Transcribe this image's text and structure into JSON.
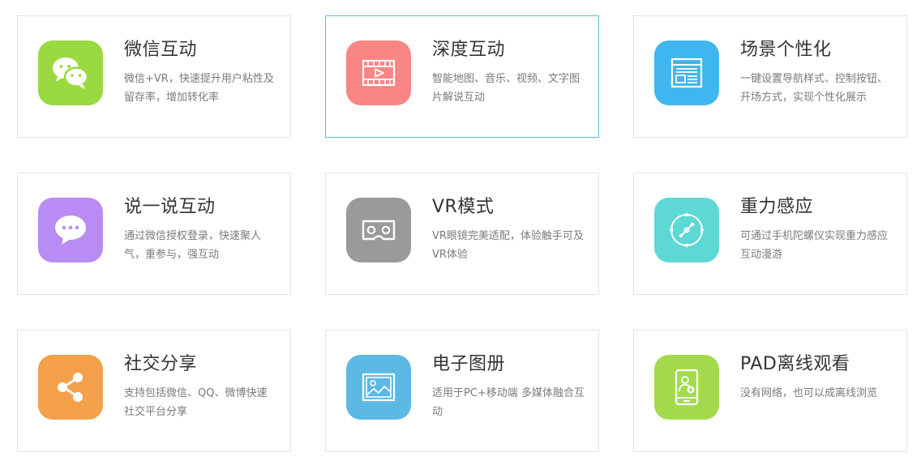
{
  "colors": {
    "wechat": "#9ad940",
    "deep": "#f98585",
    "scene": "#3fb6ef",
    "talk": "#b98cf3",
    "vr": "#9b9999",
    "gravity": "#5dd8d4",
    "social": "#f5a04a",
    "album": "#5cb9e4",
    "pad": "#a3da4b",
    "active_border": "#5bbfd0",
    "border": "#e3e3e3"
  },
  "features": [
    {
      "title": "微信互动",
      "desc": "微信+VR，快速提升用户粘性及留存率，增加转化率",
      "icon": "wechat-icon"
    },
    {
      "title": "深度互动",
      "desc": "智能地图、音乐、视频、文字图片解说互动",
      "icon": "film-icon"
    },
    {
      "title": "场景个性化",
      "desc": "一键设置导航样式、控制按钮、开场方式，实现个性化展示",
      "icon": "layout-icon"
    },
    {
      "title": "说一说互动",
      "desc": "通过微信授权登录，快速聚人气，重参与，强互动",
      "icon": "chat-bubble-icon"
    },
    {
      "title": "VR模式",
      "desc": "VR眼镜完美适配，体验触手可及VR体验",
      "icon": "vr-glasses-icon"
    },
    {
      "title": "重力感应",
      "desc": "可通过手机陀螺仪实现重力感应互动漫游",
      "icon": "compass-icon"
    },
    {
      "title": "社交分享",
      "desc": "支持包括微信、QQ、微博快速社交平台分享",
      "icon": "share-icon"
    },
    {
      "title": "电子图册",
      "desc": "适用于PC+移动端 多媒体融合互动",
      "icon": "picture-icon"
    },
    {
      "title": "PAD离线观看",
      "desc": "没有网络，也可以成离线浏览",
      "icon": "tablet-icon"
    }
  ]
}
